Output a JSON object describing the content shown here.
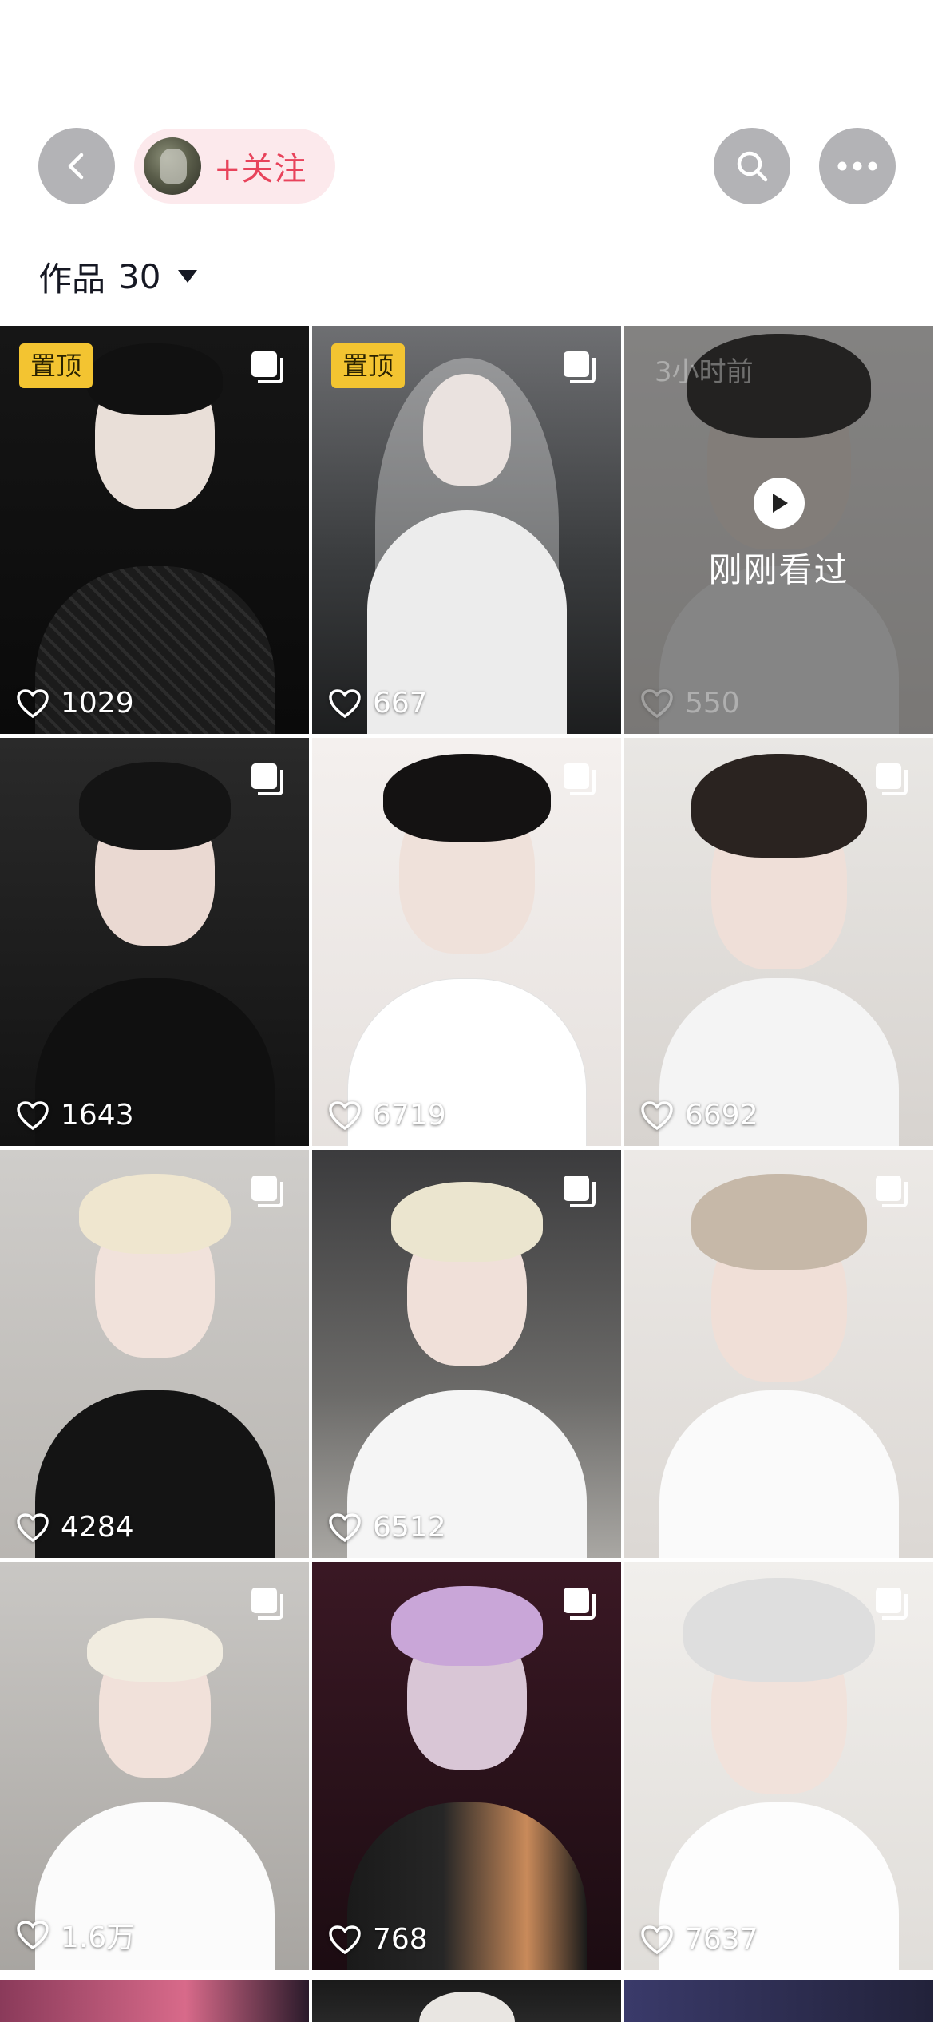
{
  "header": {
    "follow_label": "+关注",
    "works_label": "作品",
    "works_count": "30",
    "icons": {
      "back": "back-chevron-icon",
      "search": "search-icon",
      "more": "more-dots-icon",
      "caret": "caret-down-icon"
    }
  },
  "colors": {
    "follow_text": "#e8435b",
    "follow_bg": "#fce9ec",
    "pin_badge": "#f3c431",
    "header_button": "#b3b3b6"
  },
  "posts": [
    {
      "pinned": true,
      "pin_label": "置顶",
      "likes": "1029"
    },
    {
      "pinned": true,
      "pin_label": "置顶",
      "likes": "667"
    },
    {
      "pinned": false,
      "likes": "550",
      "time_ago": "3小时前",
      "overlay_text": "刚刚看过",
      "watched": true
    },
    {
      "pinned": false,
      "likes": "1643"
    },
    {
      "pinned": false,
      "likes": "6719"
    },
    {
      "pinned": false,
      "likes": "6692"
    },
    {
      "pinned": false,
      "likes": "4284"
    },
    {
      "pinned": false,
      "likes": "6512"
    },
    {
      "pinned": false,
      "likes": ""
    },
    {
      "pinned": false,
      "likes": "1.6万"
    },
    {
      "pinned": false,
      "likes": "768"
    },
    {
      "pinned": false,
      "likes": "7637"
    }
  ]
}
